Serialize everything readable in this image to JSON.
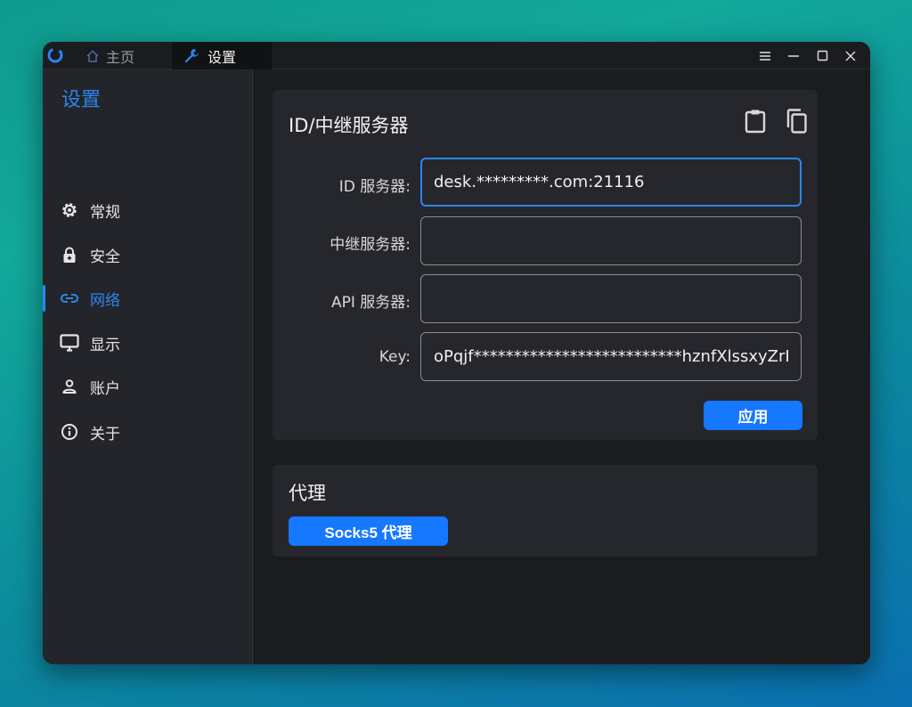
{
  "titlebar": {
    "tabs": [
      {
        "label": "主页",
        "icon": "home-icon"
      },
      {
        "label": "设置",
        "icon": "wrench-icon"
      }
    ]
  },
  "sidebar": {
    "title": "设置",
    "items": [
      {
        "label": "常规",
        "icon": "gear-icon"
      },
      {
        "label": "安全",
        "icon": "lock-icon"
      },
      {
        "label": "网络",
        "icon": "link-icon",
        "active": true
      },
      {
        "label": "显示",
        "icon": "monitor-icon"
      },
      {
        "label": "账户",
        "icon": "user-icon"
      },
      {
        "label": "关于",
        "icon": "info-icon"
      }
    ]
  },
  "relay": {
    "title": "ID/中继服务器",
    "fields": [
      {
        "label": "ID 服务器:",
        "value": "desk.*********.com:21116"
      },
      {
        "label": "中继服务器:",
        "value": ""
      },
      {
        "label": "API 服务器:",
        "value": ""
      },
      {
        "label": "Key:",
        "value": "oPqjf**************************hznfXlssxyZrLbf"
      }
    ],
    "apply_label": "应用"
  },
  "proxy": {
    "title": "代理",
    "socks_label": "Socks5 代理"
  },
  "colors": {
    "accent": "#1677ff",
    "accent_text": "#2a86f0",
    "window_bg": "#1b1c20",
    "card_bg": "#26272c"
  }
}
